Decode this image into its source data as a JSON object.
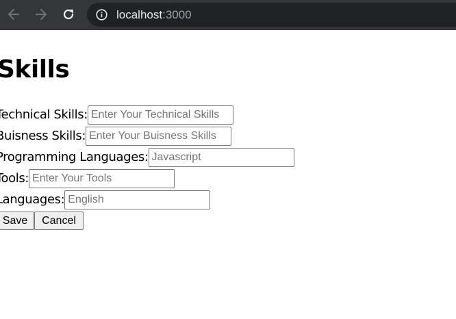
{
  "browser": {
    "url_host": "localhost",
    "url_port": ":3000",
    "icons": {
      "back": "arrow-left-icon",
      "forward": "arrow-right-icon",
      "reload": "reload-icon",
      "site_info": "info-icon"
    },
    "colors": {
      "toolbar": "#35363a",
      "omnibox": "#202124"
    }
  },
  "page": {
    "title": "Skills",
    "fields": [
      {
        "label": "Technical Skills:",
        "placeholder": "Enter Your Technical Skills",
        "value": ""
      },
      {
        "label": "Buisness Skills:",
        "placeholder": "Enter Your Buisness Skills",
        "value": ""
      },
      {
        "label": "Programming Languages:",
        "placeholder": "Javascript",
        "value": ""
      },
      {
        "label": "Tools:",
        "placeholder": "Enter Your Tools",
        "value": ""
      },
      {
        "label": "Languages:",
        "placeholder": "English",
        "value": ""
      }
    ],
    "buttons": {
      "save": "Save",
      "cancel": "Cancel"
    }
  }
}
